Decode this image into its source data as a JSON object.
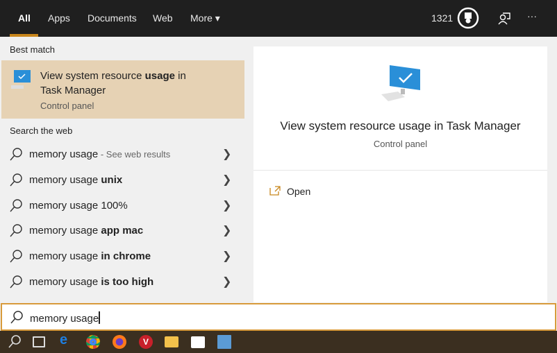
{
  "tabs": [
    "All",
    "Apps",
    "Documents",
    "Web",
    "More ▾"
  ],
  "header": {
    "points": "1321",
    "more_label": "···"
  },
  "best_match": {
    "heading": "Best match",
    "title_pre": "View system resource ",
    "title_bold": "usage",
    "title_post": " in",
    "title_line2": "Task Manager",
    "subtitle": "Control panel"
  },
  "web": {
    "heading": "Search the web",
    "items": [
      {
        "base": "memory usage",
        "bold": "",
        "sub": " - See web results"
      },
      {
        "base": "memory usage ",
        "bold": "unix",
        "sub": ""
      },
      {
        "base": "memory usage 100%",
        "bold": "",
        "sub": ""
      },
      {
        "base": "memory usage ",
        "bold": "app mac",
        "sub": ""
      },
      {
        "base": "memory usage ",
        "bold": "in chrome",
        "sub": ""
      },
      {
        "base": "memory usage ",
        "bold": "is too high",
        "sub": ""
      }
    ]
  },
  "detail": {
    "title": "View system resource usage in Task Manager",
    "subtitle": "Control panel",
    "open_label": "Open"
  },
  "search": {
    "value": "memory usage"
  },
  "colors": {
    "accent": "#c8861c",
    "highlight": "#e6d2b4",
    "taskbar": "#3b2f20"
  }
}
